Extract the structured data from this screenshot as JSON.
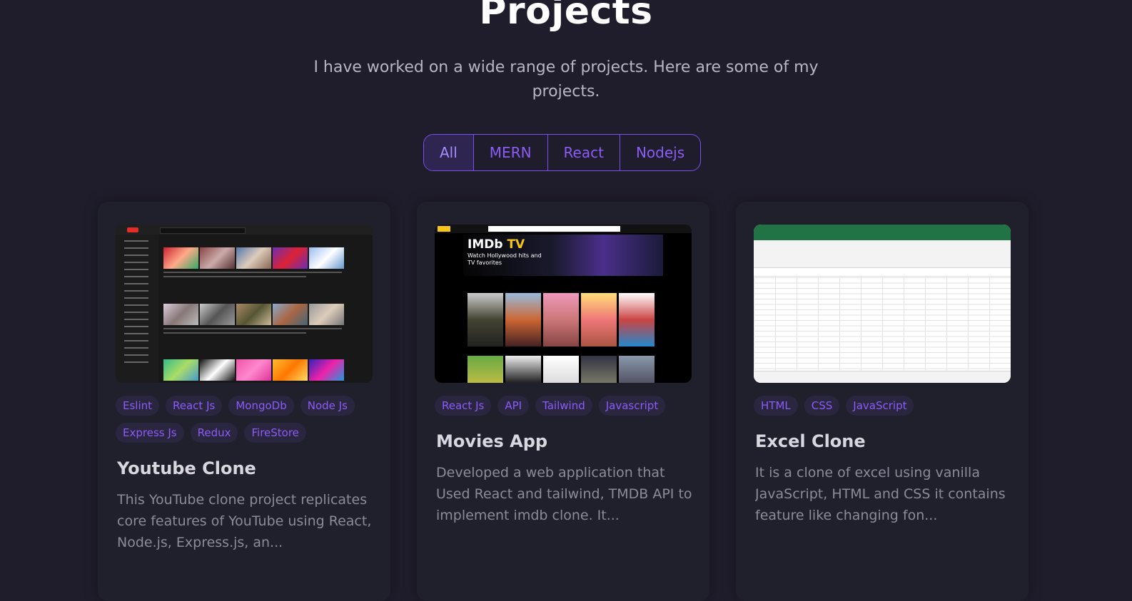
{
  "section": {
    "title": "Projects",
    "subtitle": "I have worked on a wide range of projects. Here are some of my projects."
  },
  "filters": [
    "All",
    "MERN",
    "React",
    "Nodejs"
  ],
  "active_filter": "All",
  "projects": [
    {
      "title": "Youtube Clone",
      "tags": [
        "Eslint",
        "React Js",
        "MongoDb",
        "Node Js",
        "Express Js",
        "Redux",
        "FireStore"
      ],
      "description": "This YouTube clone project replicates core features of YouTube using React, Node.js, Express.js, an..."
    },
    {
      "title": "Movies App",
      "tags": [
        "React Js",
        "API",
        "Tailwind",
        "Javascript"
      ],
      "description": "Developed a web application that Used React and tailwind, TMDB API to implement imdb clone. It..."
    },
    {
      "title": "Excel Clone",
      "tags": [
        "HTML",
        "CSS",
        "JavaScript"
      ],
      "description": "It is a clone of excel using vanilla JavaScript, HTML and CSS it contains feature like changing fon..."
    }
  ],
  "thumbs": {
    "imdb_brand": "IMDb",
    "imdb_tv": "TV",
    "imdb_tagline": "Watch Hollywood hits and TV favorites"
  },
  "colors": {
    "background": "#1f1d2b",
    "accent": "#8b5cf6",
    "card": "#201f2c"
  }
}
